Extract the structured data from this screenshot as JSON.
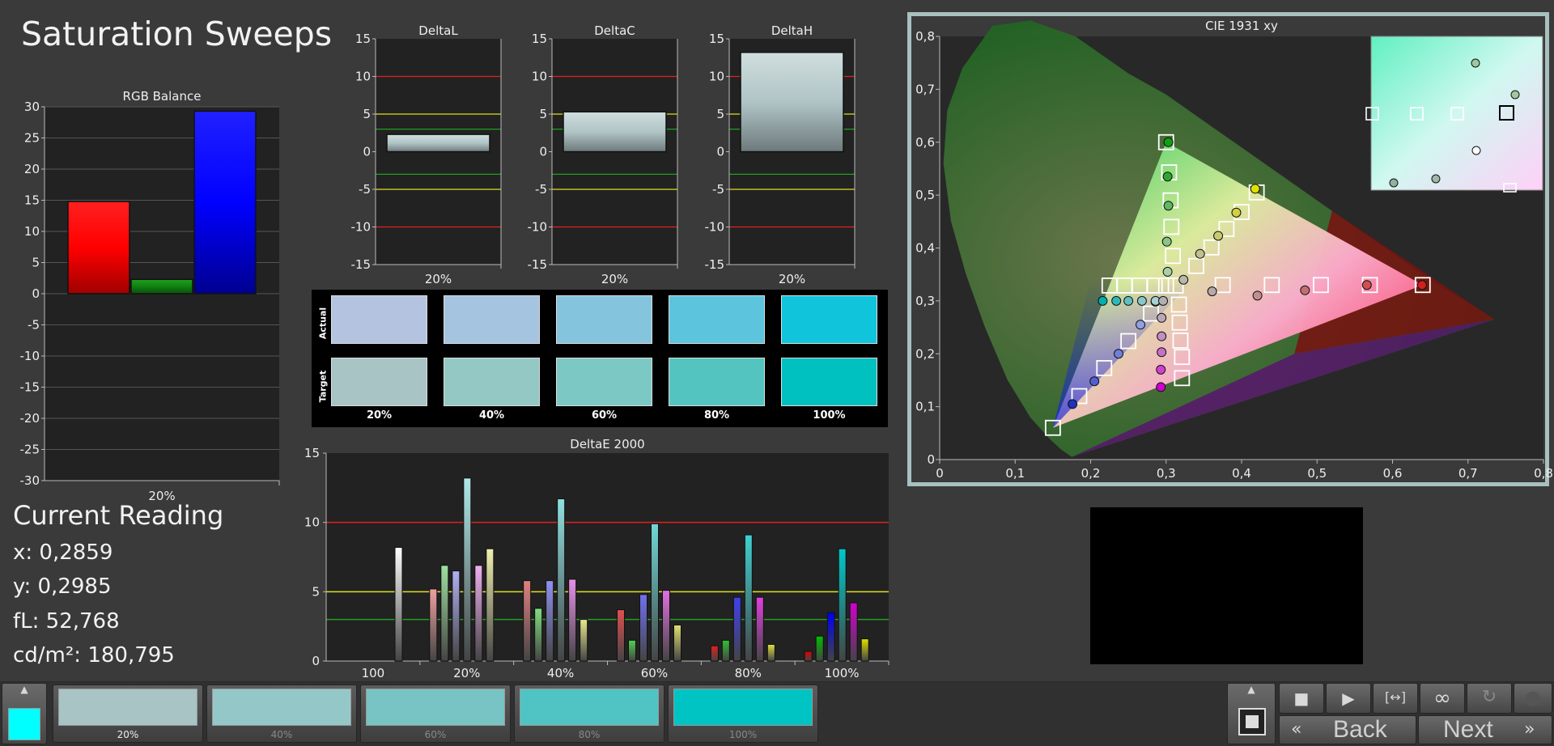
{
  "title": "Saturation Sweeps",
  "rgb_balance": {
    "title": "RGB Balance",
    "y_ticks": [
      "30",
      "25",
      "20",
      "15",
      "10",
      "5",
      "0",
      "-5",
      "-10",
      "-15",
      "-20",
      "-25",
      "-30"
    ],
    "x_label": "20%",
    "colors": {
      "red": "#ff0000",
      "green": "#1aa01a",
      "blue": "#1010ff"
    },
    "chart_data": {
      "type": "bar",
      "categories": [
        "Red",
        "Green",
        "Blue"
      ],
      "values": [
        14.8,
        2.3,
        29.3
      ],
      "ylim": [
        -30,
        30
      ],
      "title": "RGB Balance",
      "x_category": "20%"
    }
  },
  "delta_charts": {
    "y_ticks": [
      "15",
      "10",
      "5",
      "0",
      "-5",
      "-10",
      "-15"
    ],
    "x_label": "20%",
    "items": [
      {
        "title": "DeltaL",
        "value": 2.3
      },
      {
        "title": "DeltaC",
        "value": 5.3
      },
      {
        "title": "DeltaH",
        "value": 13.2
      }
    ],
    "chart_data": {
      "type": "bar",
      "categories": [
        "DeltaL",
        "DeltaC",
        "DeltaH"
      ],
      "values": [
        2.3,
        5.3,
        13.2
      ],
      "ylim": [
        -15,
        15
      ],
      "x_category": "20%"
    }
  },
  "swatches": {
    "row_labels": [
      "Actual",
      "Target"
    ],
    "col_labels": [
      "20%",
      "40%",
      "60%",
      "80%",
      "100%"
    ],
    "actual_colors": [
      "#b4c4e0",
      "#a4c4e0",
      "#84c4dc",
      "#5cc4dc",
      "#10c4dc"
    ],
    "target_colors": [
      "#a8c4c4",
      "#94c8c4",
      "#7cc8c4",
      "#54c4c0",
      "#00c0c0"
    ]
  },
  "delta_e": {
    "title": "DeltaE 2000",
    "y_ticks": [
      "15",
      "10",
      "5",
      "0"
    ],
    "x_labels": [
      "100",
      "20%",
      "40%",
      "60%",
      "80%",
      "100%"
    ],
    "chart_data": {
      "type": "bar",
      "title": "DeltaE 2000",
      "ylim": [
        0,
        15
      ],
      "groups": [
        {
          "label": "100",
          "values": [
            8.2
          ],
          "colors": [
            "#ffffff"
          ]
        },
        {
          "label": "20%",
          "values": [
            5.2,
            6.9,
            6.5,
            13.2,
            6.9,
            8.1
          ],
          "colors": [
            "#f0a0a0",
            "#a0e0a0",
            "#b0b0f0",
            "#b0e8e8",
            "#f0b0f0",
            "#f0f0b0"
          ]
        },
        {
          "label": "40%",
          "values": [
            5.8,
            3.8,
            5.8,
            11.7,
            5.9,
            3.0
          ],
          "colors": [
            "#e08080",
            "#80e080",
            "#9090f0",
            "#90e0e0",
            "#e890e8",
            "#e8e890"
          ]
        },
        {
          "label": "60%",
          "values": [
            3.7,
            1.5,
            4.8,
            9.9,
            5.1,
            2.6
          ],
          "colors": [
            "#e05050",
            "#50d050",
            "#7070f0",
            "#70d8d8",
            "#e070e0",
            "#e0e070"
          ]
        },
        {
          "label": "80%",
          "values": [
            1.1,
            1.5,
            4.6,
            9.1,
            4.6,
            1.2
          ],
          "colors": [
            "#e02020",
            "#30c030",
            "#4040f0",
            "#40d0d0",
            "#e040e0",
            "#e0e040"
          ]
        },
        {
          "label": "100%",
          "values": [
            0.7,
            1.8,
            3.5,
            8.1,
            4.2,
            1.6
          ],
          "colors": [
            "#e00000",
            "#00c000",
            "#0000f0",
            "#00c8c8",
            "#d000d0",
            "#e0e000"
          ]
        }
      ]
    }
  },
  "cie": {
    "title": "CIE 1931 xy",
    "x_ticks": [
      "0",
      "0,1",
      "0,2",
      "0,3",
      "0,4",
      "0,5",
      "0,6",
      "0,7",
      "0,8"
    ],
    "y_ticks": [
      "0",
      "0,1",
      "0,2",
      "0,3",
      "0,4",
      "0,5",
      "0,6",
      "0,7",
      "0,8"
    ],
    "chart_data": {
      "type": "scatter",
      "title": "CIE 1931 xy",
      "xlim": [
        0,
        0.8
      ],
      "ylim": [
        0,
        0.8
      ],
      "gamut": [
        [
          0.64,
          0.33
        ],
        [
          0.3,
          0.6
        ],
        [
          0.15,
          0.06
        ]
      ],
      "targets": [
        [
          0.3127,
          0.329
        ],
        [
          0.3,
          0.6
        ],
        [
          0.304,
          0.543
        ],
        [
          0.306,
          0.49
        ],
        [
          0.307,
          0.44
        ],
        [
          0.309,
          0.385
        ],
        [
          0.15,
          0.06
        ],
        [
          0.185,
          0.12
        ],
        [
          0.218,
          0.173
        ],
        [
          0.25,
          0.224
        ],
        [
          0.28,
          0.276
        ],
        [
          0.64,
          0.33
        ],
        [
          0.57,
          0.33
        ],
        [
          0.505,
          0.33
        ],
        [
          0.44,
          0.33
        ],
        [
          0.375,
          0.33
        ],
        [
          0.225,
          0.329
        ],
        [
          0.245,
          0.329
        ],
        [
          0.265,
          0.329
        ],
        [
          0.285,
          0.329
        ],
        [
          0.3,
          0.329
        ],
        [
          0.42,
          0.505
        ],
        [
          0.4,
          0.468
        ],
        [
          0.38,
          0.436
        ],
        [
          0.36,
          0.401
        ],
        [
          0.34,
          0.366
        ],
        [
          0.321,
          0.154
        ],
        [
          0.321,
          0.194
        ],
        [
          0.319,
          0.225
        ],
        [
          0.318,
          0.259
        ],
        [
          0.317,
          0.293
        ]
      ],
      "actuals": [
        {
          "x": 0.2859,
          "y": 0.2985,
          "color": "#ffffff"
        },
        {
          "x": 0.303,
          "y": 0.6,
          "color": "#10a010"
        },
        {
          "x": 0.302,
          "y": 0.535,
          "color": "#30a830"
        },
        {
          "x": 0.303,
          "y": 0.48,
          "color": "#60b860"
        },
        {
          "x": 0.301,
          "y": 0.412,
          "color": "#88c488"
        },
        {
          "x": 0.302,
          "y": 0.355,
          "color": "#a8d0a8"
        },
        {
          "x": 0.176,
          "y": 0.105,
          "color": "#2030c0"
        },
        {
          "x": 0.205,
          "y": 0.148,
          "color": "#5060d0"
        },
        {
          "x": 0.237,
          "y": 0.2,
          "color": "#7080d8"
        },
        {
          "x": 0.266,
          "y": 0.255,
          "color": "#90a0e0"
        },
        {
          "x": 0.639,
          "y": 0.33,
          "color": "#d02020"
        },
        {
          "x": 0.566,
          "y": 0.33,
          "color": "#d05050"
        },
        {
          "x": 0.484,
          "y": 0.32,
          "color": "#c07070"
        },
        {
          "x": 0.421,
          "y": 0.31,
          "color": "#c09090"
        },
        {
          "x": 0.361,
          "y": 0.318,
          "color": "#b8a8a8"
        },
        {
          "x": 0.216,
          "y": 0.3,
          "color": "#00b0b0"
        },
        {
          "x": 0.234,
          "y": 0.3,
          "color": "#30b8b8"
        },
        {
          "x": 0.25,
          "y": 0.3,
          "color": "#60c0c0"
        },
        {
          "x": 0.268,
          "y": 0.3,
          "color": "#88c8c8"
        },
        {
          "x": 0.286,
          "y": 0.3,
          "color": "#a8d0d0"
        },
        {
          "x": 0.418,
          "y": 0.512,
          "color": "#e0e000"
        },
        {
          "x": 0.393,
          "y": 0.467,
          "color": "#d0d040"
        },
        {
          "x": 0.369,
          "y": 0.423,
          "color": "#c8c870"
        },
        {
          "x": 0.345,
          "y": 0.389,
          "color": "#c0c090"
        },
        {
          "x": 0.323,
          "y": 0.34,
          "color": "#b8b8a8"
        },
        {
          "x": 0.293,
          "y": 0.137,
          "color": "#d000d0"
        },
        {
          "x": 0.293,
          "y": 0.17,
          "color": "#d040d0"
        },
        {
          "x": 0.294,
          "y": 0.203,
          "color": "#c870c8"
        },
        {
          "x": 0.294,
          "y": 0.233,
          "color": "#c090c0"
        },
        {
          "x": 0.294,
          "y": 0.268,
          "color": "#b8a8b8"
        },
        {
          "x": 0.296,
          "y": 0.3,
          "color": "#b0b0b0"
        }
      ]
    }
  },
  "current_reading": {
    "heading": "Current Reading",
    "lines": [
      "x: 0,2859",
      "y: 0,2985",
      "fL: 52,768",
      "cd/m²: 180,795"
    ]
  },
  "patches": {
    "current_color": "#00ffff",
    "items": [
      {
        "label": "20%",
        "color": "#a8c4c4",
        "active": true
      },
      {
        "label": "40%",
        "color": "#94c8c8",
        "active": false
      },
      {
        "label": "60%",
        "color": "#78c4c4",
        "active": false
      },
      {
        "label": "80%",
        "color": "#50c4c4",
        "active": false
      },
      {
        "label": "100%",
        "color": "#00c4c4",
        "active": false
      }
    ]
  },
  "navigation": {
    "back_label": "Back",
    "next_label": "Next"
  }
}
